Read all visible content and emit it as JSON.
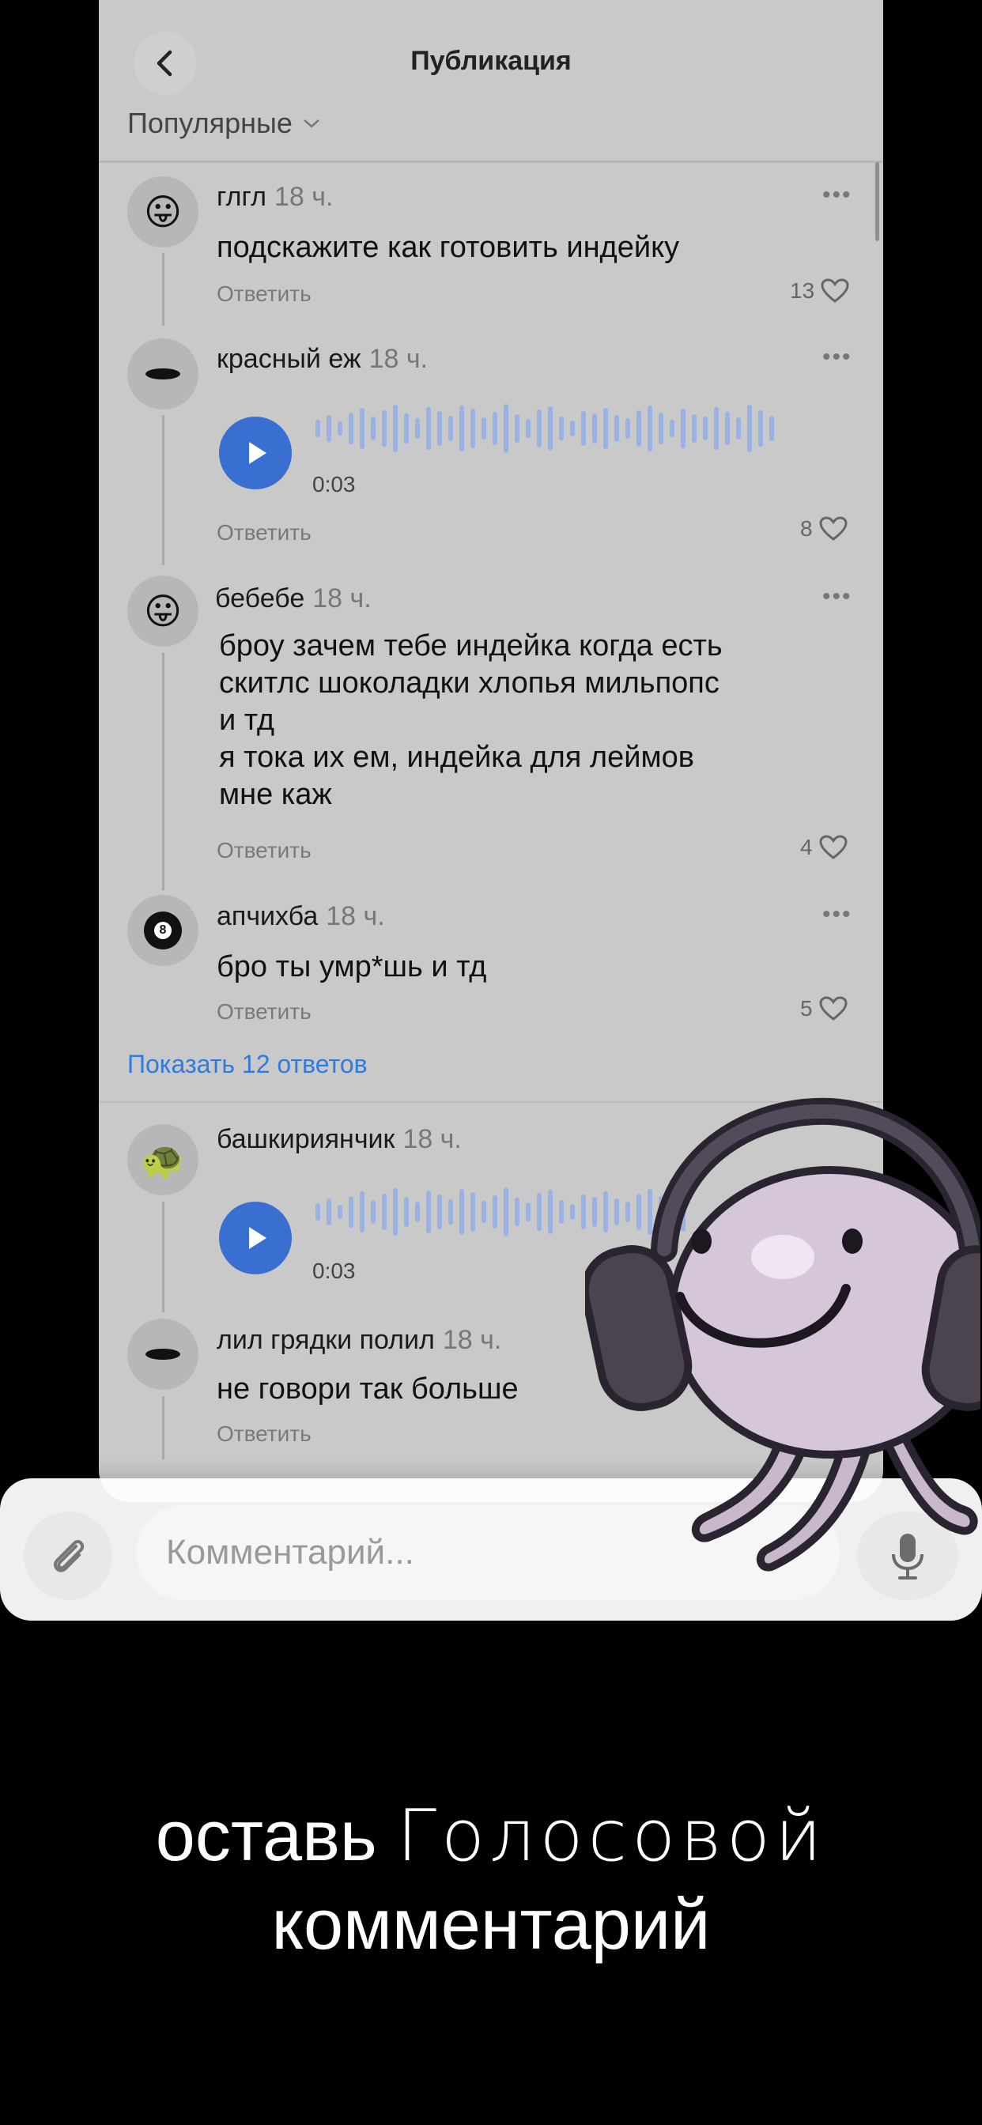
{
  "header": {
    "title": "Публикация"
  },
  "sort": {
    "label": "Популярные"
  },
  "comments": [
    {
      "author": "глгл",
      "time": "18 ч.",
      "text": "подскажите как готовить индейку",
      "reply": "Ответить",
      "likes": "13",
      "avatar": "tongue-face"
    },
    {
      "author": "красный еж",
      "time": "18 ч.",
      "voice_duration": "0:03",
      "reply": "Ответить",
      "likes": "8",
      "avatar": "dark-oval"
    },
    {
      "author": "бебебе",
      "time": "18 ч.",
      "text": "броу зачем тебе индейка когда есть\nскитлс шоколадки хлопья мильпопс\nи тд\nя тока их ем, индейка для леймов\nмне каж",
      "reply": "Ответить",
      "likes": "4",
      "avatar": "tongue-face"
    },
    {
      "author": "апчихба",
      "time": "18 ч.",
      "text": "бро ты умр*шь и тд",
      "reply": "Ответить",
      "likes": "5",
      "avatar": "8-ball"
    },
    {
      "author": "башкириянчик",
      "time": "18 ч.",
      "voice_duration": "0:03",
      "avatar": "turtle"
    },
    {
      "author": "лил грядки полил",
      "time": "18 ч.",
      "text": "не говори так больше",
      "reply": "Ответить",
      "avatar": "dark-oval"
    }
  ],
  "show_replies": "Показать 12 ответов",
  "input": {
    "placeholder": "Комментарий..."
  },
  "caption": {
    "line1_a": "оставь",
    "line1_b": "Голосовой",
    "line2": "комментарий"
  },
  "colors": {
    "accent": "#3a6fd2",
    "link": "#2f7be0",
    "background": "#000000"
  }
}
